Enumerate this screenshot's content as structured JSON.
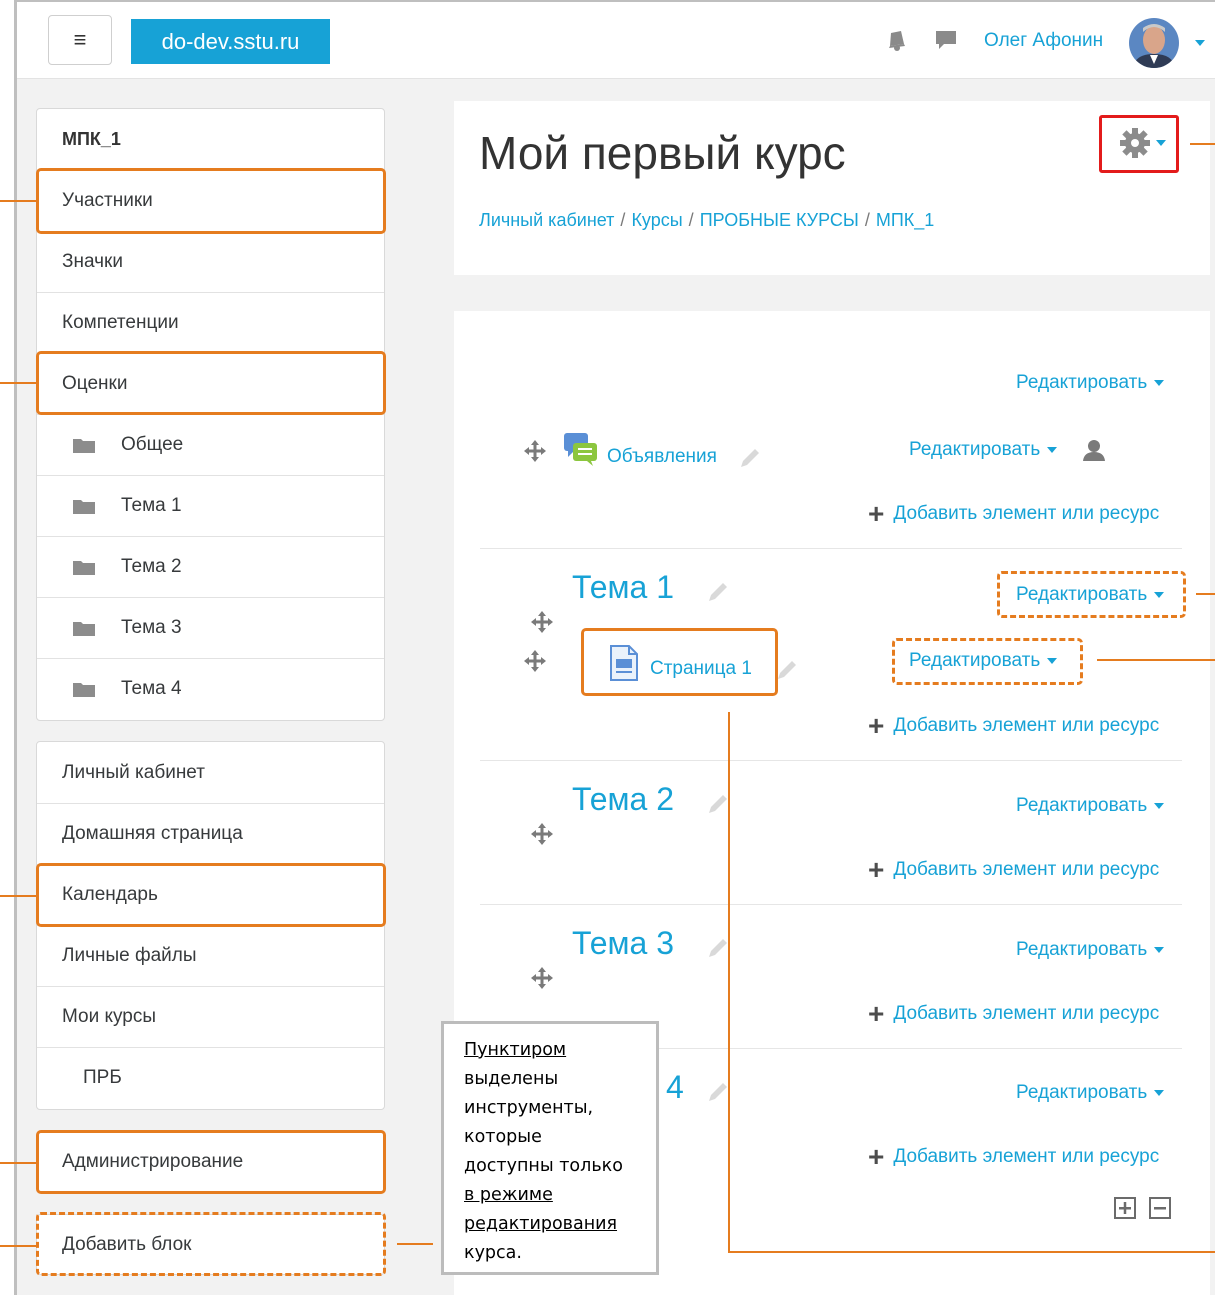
{
  "navbar": {
    "toggle_label": "≡",
    "site_name": "do-dev.sstu.ru",
    "user_name": "Олег Афонин",
    "icons": [
      "bell-icon",
      "comment-icon"
    ]
  },
  "course_nav": {
    "title": "МПК_1",
    "items": [
      {
        "label": "Участники"
      },
      {
        "label": "Значки"
      },
      {
        "label": "Компетенции"
      },
      {
        "label": "Оценки"
      },
      {
        "label": "Общее"
      },
      {
        "label": "Тема 1"
      },
      {
        "label": "Тема 2"
      },
      {
        "label": "Тема 3"
      },
      {
        "label": "Тема 4"
      }
    ]
  },
  "site_nav": {
    "items": [
      {
        "label": "Личный кабинет"
      },
      {
        "label": "Домашняя страница"
      },
      {
        "label": "Календарь"
      },
      {
        "label": "Личные файлы"
      },
      {
        "label": "Мои курсы"
      },
      {
        "label": "ПРБ"
      }
    ]
  },
  "admin_block": {
    "label": "Администрирование"
  },
  "add_block": {
    "label": "Добавить блок"
  },
  "header": {
    "title": "Мой первый курс",
    "breadcrumb": [
      "Личный кабинет",
      "Курсы",
      "ПРОБНЫЕ КУРСЫ",
      "МПК_1"
    ],
    "breadcrumb_sep": "/"
  },
  "course": {
    "edit_label": "Редактировать",
    "add_label": "Добавить элемент или ресурс",
    "general": {
      "activity": "Объявления"
    },
    "sections": [
      {
        "title": "Тема 1",
        "activity": "Страница 1"
      },
      {
        "title": "Тема 2"
      },
      {
        "title": "Тема 3"
      },
      {
        "title": "Тема 4",
        "visible_fragment": "4"
      }
    ]
  },
  "note": {
    "line1": "Пунктиром",
    "line2": "выделены",
    "line3": "инструменты,",
    "line4": "которые",
    "line5": "доступны только",
    "line6": "в режиме",
    "line7": "редактирования",
    "line8": "курса."
  },
  "colors": {
    "accent": "#17a2d6",
    "highlight": "#e57c1f",
    "gear_highlight": "#e31b1b"
  }
}
